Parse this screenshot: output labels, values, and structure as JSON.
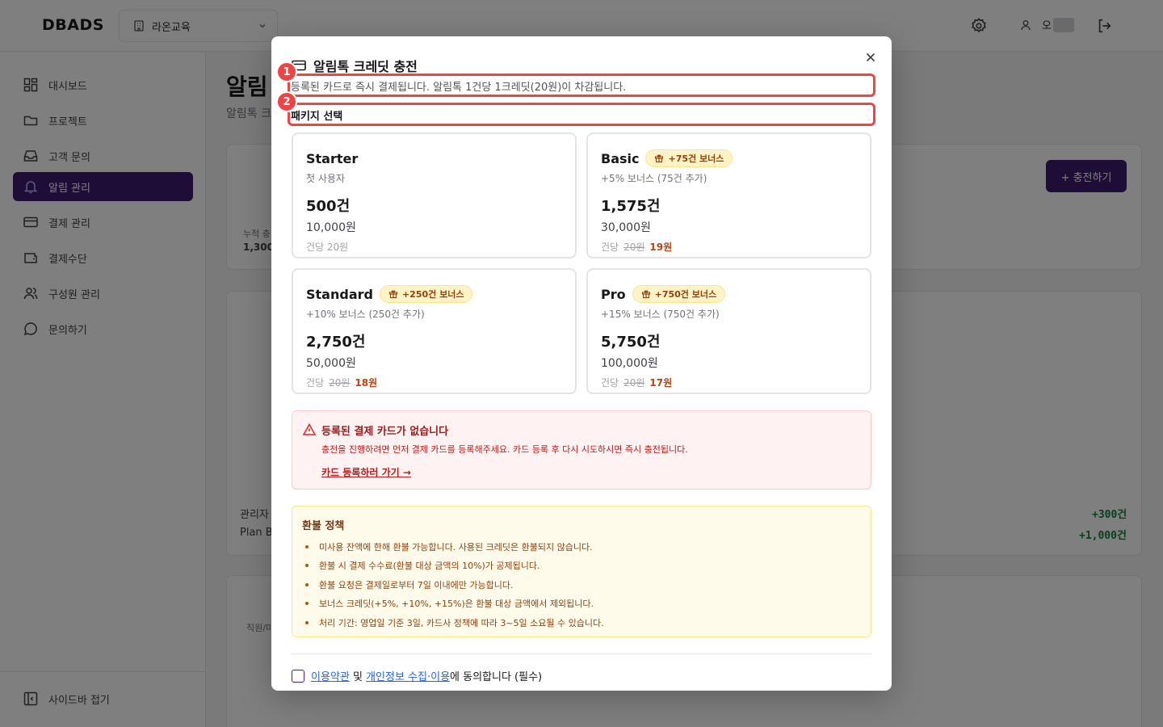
{
  "app": {
    "logo": "DBADS",
    "org_select": "라온교육",
    "user_initial": "오"
  },
  "sidebar": {
    "items": [
      {
        "label": "대시보드",
        "icon": "dashboard-icon"
      },
      {
        "label": "프로젝트",
        "icon": "folder-icon"
      },
      {
        "label": "고객 문의",
        "icon": "inbox-icon"
      },
      {
        "label": "알림 관리",
        "icon": "bell-icon",
        "active": true
      },
      {
        "label": "결제 관리",
        "icon": "credit-card-icon"
      },
      {
        "label": "결제수단",
        "icon": "wallet-icon"
      },
      {
        "label": "구성원 관리",
        "icon": "users-icon"
      },
      {
        "label": "문의하기",
        "icon": "message-icon"
      }
    ],
    "collapse_label": "사이드바 접기"
  },
  "main": {
    "title": "알림",
    "subtitle": "알림톡 크",
    "charge_button": "+ 충전하기",
    "cumulative_label": "누적 충",
    "cumulative_value": "1,300",
    "row1_label": "관리자",
    "row1_value": "+300건",
    "row2_label": "Plan B",
    "row2_value": "+1,000건",
    "section3_label": "직원/마"
  },
  "modal": {
    "title": "알림톡 크레딧 충전",
    "description": "등록된 카드로 즉시 결제됩니다. 알림톡 1건당 1크레딧(20원)이 차감됩니다.",
    "package_label": "패키지 선택",
    "annotation_1": "1",
    "annotation_2": "2",
    "packages": [
      {
        "name": "Starter",
        "bonus_tag": "",
        "desc": "첫 사용자",
        "count": "500건",
        "price": "10,000원",
        "unit_label": "건당 20원",
        "old_unit": "",
        "new_unit": ""
      },
      {
        "name": "Basic",
        "bonus_tag": "+75건 보너스",
        "desc": "+5% 보너스 (75건 추가)",
        "count": "1,575건",
        "price": "30,000원",
        "unit_label": "건당",
        "old_unit": "20원",
        "new_unit": "19원"
      },
      {
        "name": "Standard",
        "bonus_tag": "+250건 보너스",
        "desc": "+10% 보너스 (250건 추가)",
        "count": "2,750건",
        "price": "50,000원",
        "unit_label": "건당",
        "old_unit": "20원",
        "new_unit": "18원"
      },
      {
        "name": "Pro",
        "bonus_tag": "+750건 보너스",
        "desc": "+15% 보너스 (750건 추가)",
        "count": "5,750건",
        "price": "100,000원",
        "unit_label": "건당",
        "old_unit": "20원",
        "new_unit": "17원"
      }
    ],
    "alert": {
      "title": "등록된 결제 카드가 없습니다",
      "desc": "충전을 진행하려면 먼저 결제 카드를 등록해주세요. 카드 등록 후 다시 시도하시면 즉시 충전됩니다.",
      "link": "카드 등록하러 가기 →"
    },
    "refund": {
      "title": "환불 정책",
      "items": [
        "미사용 잔액에 한해 환불 가능합니다. 사용된 크레딧은 환불되지 않습니다.",
        "환불 시 결제 수수료(환불 대상 금액의 10%)가 공제됩니다.",
        "환불 요청은 결제일로부터 7일 이내에만 가능합니다.",
        "보너스 크레딧(+5%, +10%, +15%)은 환불 대상 금액에서 제외됩니다.",
        "처리 기간: 영업일 기준 3일, 카드사 정책에 따라 3~5일 소요될 수 있습니다."
      ]
    },
    "agree": {
      "terms_link": "이용약관",
      "and": " 및 ",
      "privacy_link": "개인정보 수집·이용",
      "suffix": "에 동의합니다 (필수)"
    }
  },
  "colors": {
    "brand": "#3b1b6e",
    "highlight": "#ef4444",
    "bonus": "#c2410c"
  }
}
